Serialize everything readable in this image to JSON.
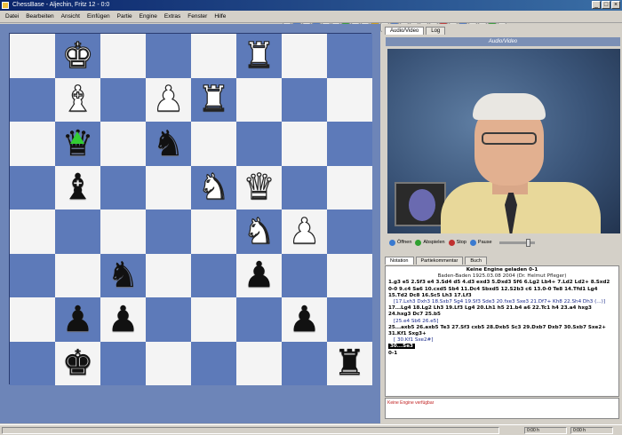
{
  "window": {
    "title": "ChessBase - Aljechin, Fritz 12 - 0:0",
    "buttons": [
      "_",
      "□",
      "×"
    ]
  },
  "menu": [
    "Datei",
    "Bearbeiten",
    "Ansicht",
    "Einfügen",
    "Partie",
    "Engine",
    "Extras",
    "Fenster",
    "Hilfe"
  ],
  "board": {
    "orientation": "white",
    "pieces": [
      {
        "sq": "b8",
        "glyph": "♚",
        "color": "white",
        "name": "white-king"
      },
      {
        "sq": "f8",
        "glyph": "♜",
        "color": "white",
        "name": "white-rook"
      },
      {
        "sq": "b7",
        "glyph": "♝",
        "color": "white",
        "name": "white-bishop"
      },
      {
        "sq": "d7",
        "glyph": "♟",
        "color": "white",
        "name": "white-pawn"
      },
      {
        "sq": "e7",
        "glyph": "♜",
        "color": "white",
        "name": "white-rook"
      },
      {
        "sq": "b6",
        "glyph": "♛",
        "color": "black",
        "name": "black-queen"
      },
      {
        "sq": "d6",
        "glyph": "♞",
        "color": "black",
        "name": "black-knight"
      },
      {
        "sq": "b5",
        "glyph": "♝",
        "color": "black",
        "name": "black-bishop"
      },
      {
        "sq": "e5",
        "glyph": "♞",
        "color": "white",
        "name": "white-knight"
      },
      {
        "sq": "f5",
        "glyph": "♛",
        "color": "white",
        "name": "white-queen"
      },
      {
        "sq": "f4",
        "glyph": "♞",
        "color": "white",
        "name": "white-knight"
      },
      {
        "sq": "g4",
        "glyph": "♟",
        "color": "white",
        "name": "white-pawn"
      },
      {
        "sq": "c3",
        "glyph": "♞",
        "color": "black",
        "name": "black-knight"
      },
      {
        "sq": "f3",
        "glyph": "♟",
        "color": "black",
        "name": "black-pawn"
      },
      {
        "sq": "b2",
        "glyph": "♟",
        "color": "black",
        "name": "black-pawn"
      },
      {
        "sq": "c2",
        "glyph": "♟",
        "color": "black",
        "name": "black-pawn"
      },
      {
        "sq": "g2",
        "glyph": "♟",
        "color": "black",
        "name": "black-pawn"
      },
      {
        "sq": "b1",
        "glyph": "♚",
        "color": "black",
        "name": "black-king"
      },
      {
        "sq": "h1",
        "glyph": "♜",
        "color": "black",
        "name": "black-rook"
      }
    ],
    "colors": {
      "light": "#f4f4f4",
      "dark": "#5d7ab9",
      "arrow": "#33cc33"
    }
  },
  "right": {
    "tabs": [
      "Audio/Video",
      "Log"
    ],
    "video_title": "Audio/Video",
    "controls": [
      "Öffnen",
      "Abspielen",
      "Stop",
      "Pause"
    ],
    "notation_tabs": [
      "Notation",
      "Partiekommentar",
      "Buch"
    ],
    "notation": {
      "header": "Keine Engine geladen  0-1",
      "subheader": "Baden-Baden 1925.03.08  2004 (Dr. Helmut Pfleger)",
      "lines": [
        {
          "type": "mv",
          "text": "1.g3 e5 2.Sf3 e4 3.Sd4 d5 4.d3 exd3 5.Dxd3 Sf6 6.Lg2 Lb4+ 7.Ld2 Ld2+ 8.Sxd2 0-0 9.c4 Sa6 10.cxd5 Sb4 11.Dc4 Sbxd5 12.S2b3 c6 13.0-0 Te8 14.Tfd1 Lg4 15.Td2 Dc8 16.Sc5 Lh3 17.Lf3"
        },
        {
          "type": "comment",
          "text": "[17.Lxh3 Dxh3 18.Sxb7 Sg4 19.Sf3 Sde3 20.fxe3 Sxe3 21.Df7+ Kh8 22.Sh4 Dh3 (...)]"
        },
        {
          "type": "mv",
          "text": "17...Lg4 18.Lg2 Lh3 19.Lf3 Lg4 20.Lh1 h5 21.b4 a6 22.Tc1 h4 23.a4 hxg3 24.hxg3 Dc7 25.b5"
        },
        {
          "type": "comment",
          "text": "[25.e4 Sb6 26.e5]"
        },
        {
          "type": "mv",
          "text": "25...axb5 26.axb5 Te3 27.Sf3 cxb5 28.Dxb5 Sc3 29.Dxb7 Dxb7 30.Sxb7 Sxe2+ 31.Kf1 Sxg3+"
        },
        {
          "type": "comment",
          "text": "[ 30.Kf1 Sxe2#]"
        },
        {
          "type": "cur",
          "text": "30...Se3"
        },
        {
          "type": "mv",
          "text": "0-1"
        }
      ]
    },
    "bottom_text": "Keine Engine verfügbar"
  },
  "status": [
    "",
    "0:00 h",
    "0:00 h"
  ]
}
